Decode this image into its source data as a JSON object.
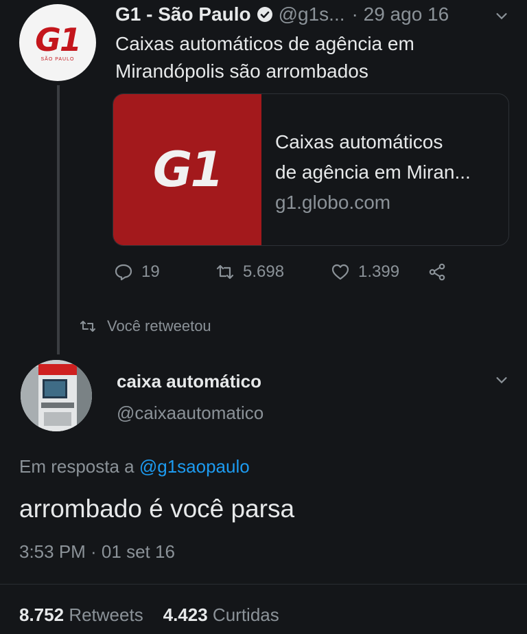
{
  "tweet1": {
    "avatar_logo": "G1",
    "avatar_sub": "SÃO PAULO",
    "name": "G1 - São Paulo",
    "handle": "@g1s...",
    "date": "· 29 ago 16",
    "text_line1": "Caixas automáticos de agência em",
    "text_line2": "Mirandópolis são arrombados",
    "card": {
      "thumb_logo": "G1",
      "title_line1": "Caixas automáticos",
      "title_line2": "de agência em Miran...",
      "domain": "g1.globo.com"
    },
    "actions": {
      "replies": "19",
      "retweets": "5.698",
      "likes": "1.399"
    }
  },
  "retweet_note": "Você retweetou",
  "tweet2": {
    "name": "caixa automático",
    "handle": "@caixaautomatico",
    "reply_prefix": "Em resposta a ",
    "reply_handle": "@g1saopaulo",
    "text": "arrombado é você parsa",
    "timestamp": "3:53 PM · 01 set 16",
    "retweets_count": "8.752",
    "retweets_label": "Retweets",
    "likes_count": "4.423",
    "likes_label": "Curtidas"
  },
  "icons": {
    "verified": "verified-badge-icon",
    "chevron": "chevron-down-icon",
    "reply": "reply-icon",
    "retweet": "retweet-icon",
    "like": "heart-icon",
    "share": "share-icon"
  },
  "colors": {
    "background": "#141619",
    "text": "#e7e9ea",
    "muted": "#8b9298",
    "link": "#1d9bf0",
    "g1_red": "#a3191c"
  }
}
